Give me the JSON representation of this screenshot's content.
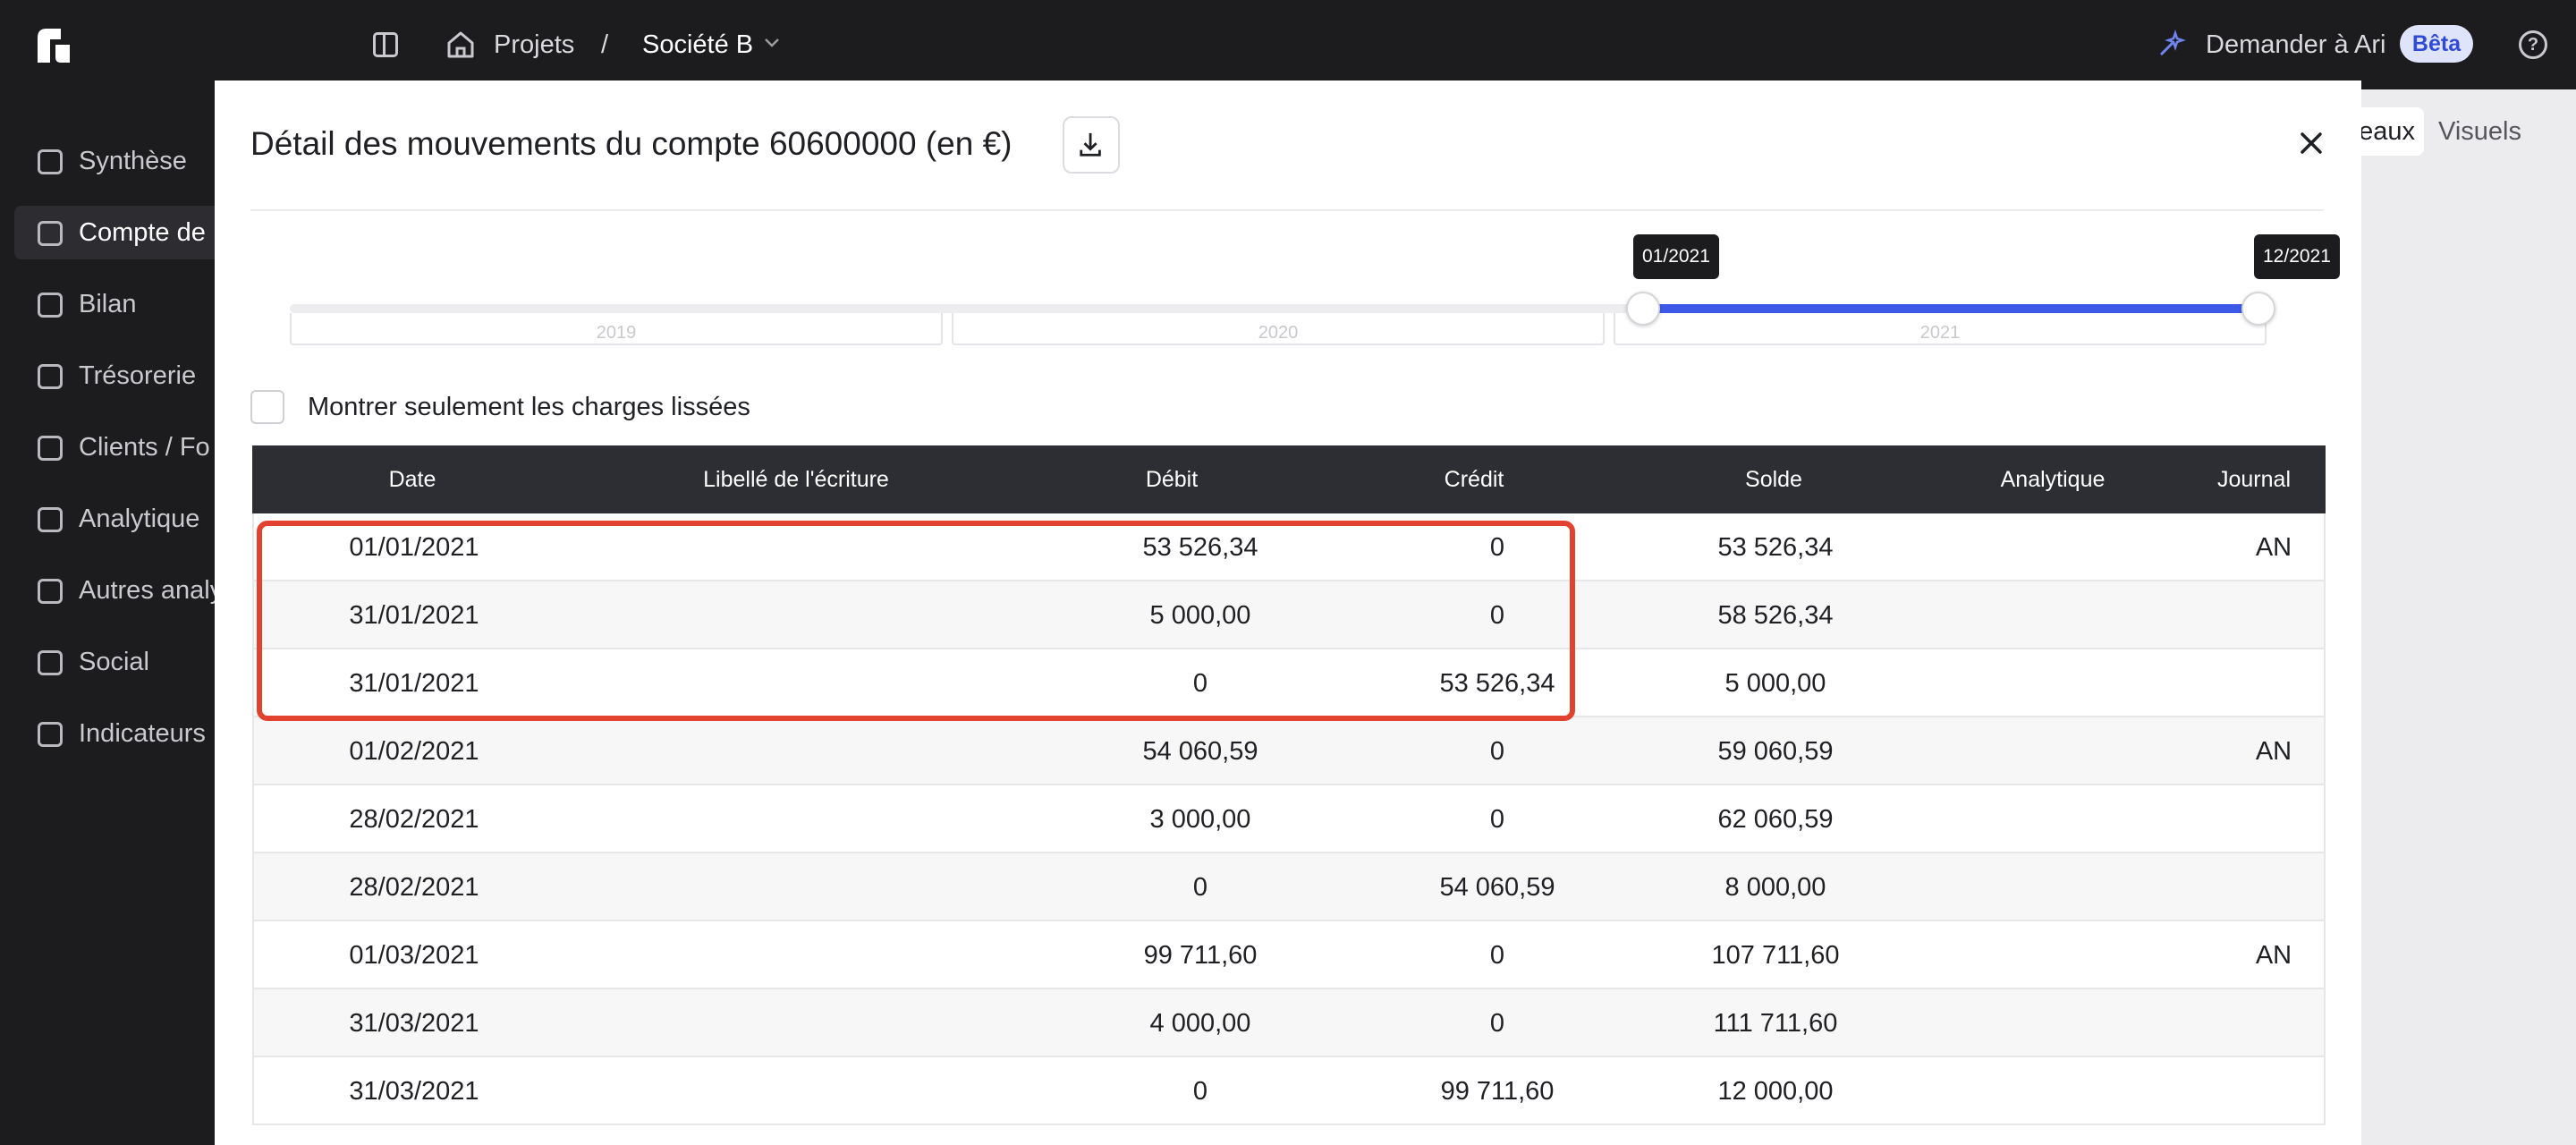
{
  "topbar": {
    "breadcrumb_projects": "Projets",
    "breadcrumb_separator": "/",
    "breadcrumb_company": "Société B",
    "ask_ai_label": "Demander à Ari",
    "beta_badge": "Bêta",
    "help_label": "?"
  },
  "sidebar": {
    "items": [
      {
        "label": "Synthèse",
        "icon": "presentation-icon"
      },
      {
        "label": "Compte de",
        "icon": "bar-chart-icon"
      },
      {
        "label": "Bilan",
        "icon": "book-icon"
      },
      {
        "label": "Trésorerie",
        "icon": "coins-icon"
      },
      {
        "label": "Clients / Fo",
        "icon": "users-building-icon"
      },
      {
        "label": "Analytique",
        "icon": "pie-chart-icon"
      },
      {
        "label": "Autres analy",
        "icon": "bike-icon"
      },
      {
        "label": "Social",
        "icon": "user-icon"
      },
      {
        "label": "Indicateurs",
        "icon": "gauge-icon"
      }
    ],
    "active_index": 1
  },
  "background_tabs": {
    "tableaux": "eaux",
    "visuels": "Visuels"
  },
  "modal": {
    "title": "Détail des mouvements du compte 60600000 (en €)",
    "slider": {
      "years": [
        "2019",
        "2020",
        "2021"
      ],
      "start_label": "01/2021",
      "end_label": "12/2021",
      "selected_fraction_start": 0.745,
      "selected_fraction_end": 1.0
    },
    "checkbox_label": "Montrer seulement les charges lissées",
    "checkbox_checked": false,
    "table": {
      "columns": [
        "Date",
        "Libellé de l'écriture",
        "Débit",
        "Crédit",
        "Solde",
        "Analytique",
        "Journal"
      ],
      "rows": [
        {
          "date": "01/01/2021",
          "libelle": "",
          "debit": "53 526,34",
          "credit": "0",
          "solde": "53 526,34",
          "analytique": "",
          "journal": "AN"
        },
        {
          "date": "31/01/2021",
          "libelle": "",
          "debit": "5 000,00",
          "credit": "0",
          "solde": "58 526,34",
          "analytique": "",
          "journal": ""
        },
        {
          "date": "31/01/2021",
          "libelle": "",
          "debit": "0",
          "credit": "53 526,34",
          "solde": "5 000,00",
          "analytique": "",
          "journal": ""
        },
        {
          "date": "01/02/2021",
          "libelle": "",
          "debit": "54 060,59",
          "credit": "0",
          "solde": "59 060,59",
          "analytique": "",
          "journal": "AN"
        },
        {
          "date": "28/02/2021",
          "libelle": "",
          "debit": "3 000,00",
          "credit": "0",
          "solde": "62 060,59",
          "analytique": "",
          "journal": ""
        },
        {
          "date": "28/02/2021",
          "libelle": "",
          "debit": "0",
          "credit": "54 060,59",
          "solde": "8 000,00",
          "analytique": "",
          "journal": ""
        },
        {
          "date": "01/03/2021",
          "libelle": "",
          "debit": "99 711,60",
          "credit": "0",
          "solde": "107 711,60",
          "analytique": "",
          "journal": "AN"
        },
        {
          "date": "31/03/2021",
          "libelle": "",
          "debit": "4 000,00",
          "credit": "0",
          "solde": "111 711,60",
          "analytique": "",
          "journal": ""
        },
        {
          "date": "31/03/2021",
          "libelle": "",
          "debit": "0",
          "credit": "99 711,60",
          "solde": "12 000,00",
          "analytique": "",
          "journal": ""
        }
      ]
    }
  },
  "colors": {
    "accent": "#3c5ae6",
    "highlight": "#e1432e",
    "topbar_bg": "#1c1c1f",
    "table_header_bg": "#2d2e33"
  }
}
